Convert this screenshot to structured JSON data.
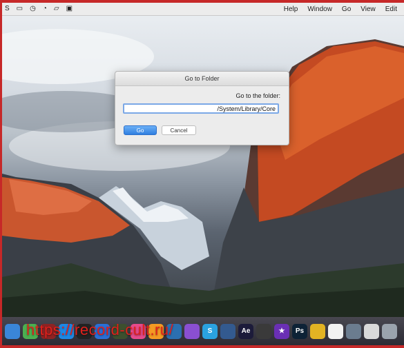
{
  "menubar": {
    "status_left": "S",
    "menus": [
      "Edit",
      "View",
      "Go",
      "Window",
      "Help"
    ]
  },
  "dialog": {
    "title": "Go to Folder",
    "label": "Go to the folder:",
    "path_value": "/System/Library/Core",
    "go_label": "Go",
    "cancel_label": "Cancel"
  },
  "dock": {
    "icons": [
      {
        "name": "finder-icon",
        "color": "#3a86d8",
        "glyph": ""
      },
      {
        "name": "maps-icon",
        "color": "#4caf50",
        "glyph": ""
      },
      {
        "name": "photo-booth-icon",
        "color": "#8e2323",
        "glyph": ""
      },
      {
        "name": "safari-icon",
        "color": "#1e88e5",
        "glyph": ""
      },
      {
        "name": "terminal-icon",
        "color": "#222222",
        "glyph": ""
      },
      {
        "name": "app-store-icon",
        "color": "#2a6fd6",
        "glyph": ""
      },
      {
        "name": "preview-icon",
        "color": "#3d4f2e",
        "glyph": ""
      },
      {
        "name": "itunes-icon",
        "color": "#e64a8b",
        "glyph": ""
      },
      {
        "name": "ibooks-icon",
        "color": "#f59a23",
        "glyph": ""
      },
      {
        "name": "xcode-icon",
        "color": "#2b6fb0",
        "glyph": ""
      },
      {
        "name": "quicktime-icon",
        "color": "#8a4fd1",
        "glyph": ""
      },
      {
        "name": "skype-icon",
        "color": "#2aa2e0",
        "glyph": "S"
      },
      {
        "name": "screenshot-icon",
        "color": "#335a8f",
        "glyph": ""
      },
      {
        "name": "after-effects-icon",
        "color": "#1c1b3a",
        "glyph": "Ae"
      },
      {
        "name": "clapper-icon",
        "color": "#3a3a3a",
        "glyph": ""
      },
      {
        "name": "imovie-icon",
        "color": "#6a2fb5",
        "glyph": "★"
      },
      {
        "name": "photoshop-icon",
        "color": "#0d2236",
        "glyph": "Ps"
      },
      {
        "name": "color-wheel-icon",
        "color": "#e2b323",
        "glyph": ""
      },
      {
        "name": "calendar-icon",
        "color": "#f2f2f2",
        "glyph": ""
      },
      {
        "name": "drive-icon",
        "color": "#6b7c8f",
        "glyph": ""
      },
      {
        "name": "notes-icon",
        "color": "#d9d9d9",
        "glyph": ""
      },
      {
        "name": "trash-icon",
        "color": "#9aa3ad",
        "glyph": ""
      }
    ],
    "watermark": "https://record-cult.ru/"
  }
}
